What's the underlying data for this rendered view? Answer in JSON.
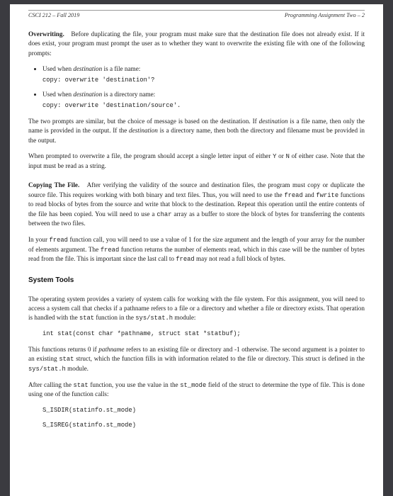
{
  "header": {
    "left": "CSCI 212 – Fall 2019",
    "right": "Programming Assignment Two  –  2"
  },
  "s1": {
    "runin": "Overwriting.",
    "p1a": "Before duplicating the file, your program must make sure that the destination file does not already exist. If it does exist, your program must prompt the user as to whether they want to overwrite the existing file with one of the following prompts:",
    "b1_lead": "Used when ",
    "b1_dest": "destination",
    "b1_tail": " is a file name:",
    "b1_code": "copy: overwrite 'destination'?",
    "b2_lead": "Used when ",
    "b2_dest": "destination",
    "b2_tail": " is a directory name:",
    "b2_code": "copy: overwrite 'destination/source'.",
    "p2a": "The two prompts are similar, but the choice of message is based on the destination. If ",
    "p2b": "destination",
    "p2c": " is a file name, then only the name is provided in the output. If the ",
    "p2d": "destination",
    "p2e": " is a directory name, then both the directory and filename must be provided in the output.",
    "p3a": "When prompted to overwrite a file, the program should accept a single letter input of either ",
    "p3b": "Y",
    "p3c": " or ",
    "p3d": "N",
    "p3e": " of either case. Note that the input must be read as a string."
  },
  "s2": {
    "runin": "Copying The File.",
    "p1a": "After verifying the validity of the source and destination files, the program must copy or duplicate the source file. This requires working with both binary and text files. Thus, you will need to use the ",
    "c1": "fread",
    "p1b": " and ",
    "c2": "fwrite",
    "p1c": " functions to read blocks of bytes from the source and write that block to the destination. Repeat this operation until the entire contents of the file has been copied. You will need to use a ",
    "c3": "char",
    "p1d": " array as a buffer to store the block of bytes for transferring the contents between the two files.",
    "p2a": "In your ",
    "c4": "fread",
    "p2b": " function call, you will need to use a value of 1 for the size argument and the length of your array for the number of elements argument. The ",
    "c5": "fread",
    "p2c": " function returns the number of elements read, which in this case will be the number of bytes read from the file. This is important since the last call to ",
    "c6": "fread",
    "p2d": " may not read a full block of bytes."
  },
  "s3": {
    "heading": "System Tools",
    "p1a": "The operating system provides a variety of system calls for working with the file system. For this assignment, you will need to access a system call that checks if a pathname refers to a file or a directory and whether a file or directory exists. That operation is handled with the ",
    "c1": "stat",
    "p1b": " function in the ",
    "c2": "sys/stat.h",
    "p1c": " module:",
    "code1": "int stat(const char *pathname, struct stat *statbuf);",
    "p2a": "This functions returns 0 if ",
    "i1": "pathname",
    "p2b": " refers to an existing file or directory and -1 otherwise. The second argument is a pointer to an existing ",
    "c3": "stat",
    "p2c": " struct, which the function fills in with information related to the file or directory. This struct is defined in the ",
    "c4": "sys/stat.h",
    "p2d": " module.",
    "p3a": "After calling the ",
    "c5": "stat",
    "p3b": " function, you use the value in the ",
    "c6": "st_mode",
    "p3c": " field of the struct to determine the type of file. This is done using one of the function calls:",
    "code2": "S_ISDIR(statinfo.st_mode)",
    "code3": "S_ISREG(statinfo.st_mode)"
  }
}
